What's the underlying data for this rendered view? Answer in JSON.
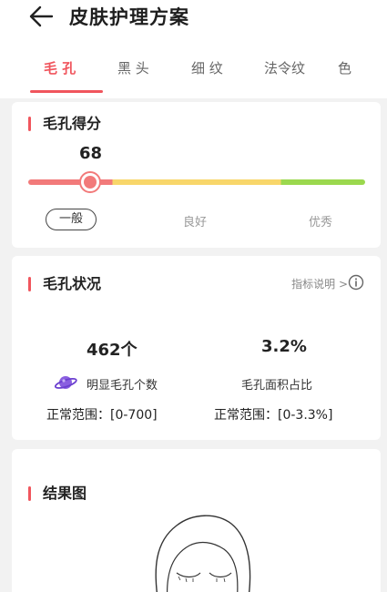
{
  "header": {
    "title": "皮肤护理方案"
  },
  "tabs": [
    {
      "label": "毛  孔",
      "active": true
    },
    {
      "label": "黑  头",
      "active": false
    },
    {
      "label": "细  纹",
      "active": false
    },
    {
      "label": "法令纹",
      "active": false
    },
    {
      "label": "色",
      "active": false
    }
  ],
  "score_card": {
    "title": "毛孔得分",
    "score": "68",
    "levels": [
      "一般",
      "良好",
      "优秀"
    ],
    "selected_level": "一般"
  },
  "status_card": {
    "title": "毛孔状况",
    "info_link": "指标说明 >",
    "metrics": [
      {
        "value": "462个",
        "label": "明显毛孔个数",
        "range": "正常范围：[0-700]"
      },
      {
        "value": "3.2%",
        "label": "毛孔面积占比",
        "range": "正常范围：[0-3.3%]"
      }
    ]
  },
  "result_card": {
    "title": "结果图"
  },
  "colors": {
    "accent": "#f0555d",
    "bar_low": "#f27a7a",
    "bar_mid": "#f8d66a",
    "bar_high": "#9bd84e",
    "planet": "#8a5fe0"
  },
  "icons": [
    "back-arrow-icon",
    "info-icon",
    "planet-icon"
  ]
}
